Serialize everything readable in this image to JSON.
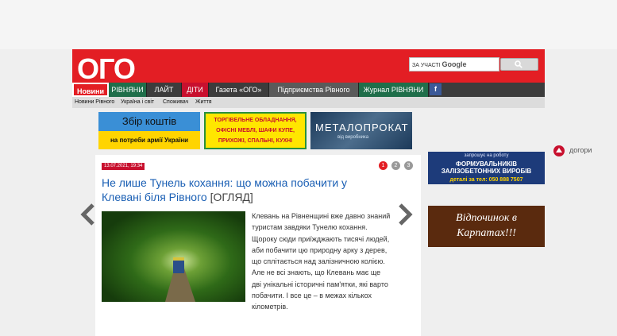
{
  "logo": "ОГО",
  "search": {
    "by": "ЗА УЧАСТІ",
    "brand": "Google"
  },
  "nav": [
    {
      "label": "Новини"
    },
    {
      "label": "РІВНЯНИ"
    },
    {
      "label": "ЛАЙТ"
    },
    {
      "label": "ДІТИ"
    },
    {
      "label": "Газета «ОГО»"
    },
    {
      "label": "Підприємства Рівного"
    },
    {
      "label": "Журнал РІВНЯНИ"
    },
    {
      "label": "f"
    }
  ],
  "subnav": [
    "Новини Рівного",
    "Україна і світ",
    "Споживач",
    "Життя"
  ],
  "banners": {
    "b1_line1": "Збір коштів",
    "b1_line2": "на потреби армії України",
    "b2": [
      "ТОРГІВЕЛЬНЕ ОБЛАДНАННЯ,",
      "ОФІСНІ МЕБЛІ, ШАФИ КУПЕ,",
      "ПРИХОЖІ, СПАЛЬНІ, КУХНІ"
    ],
    "b3_line1": "МЕТАЛОПРОКАТ",
    "b3_line2": "від виробника"
  },
  "article": {
    "date": "13.07.2021, 19:34",
    "pages": [
      "1",
      "2",
      "3"
    ],
    "title": "Не лише Тунель кохання: що можна побачити у Клевані біля Рівного",
    "tag": "[ОГЛЯД]",
    "body": "Клевань на Рівненщині вже давно знаний туристам завдяки Тунелю кохання. Щороку сюди приїжджають тисячі людей, аби побачити цю природну арку з дерев, що сплітається над залізничною колією. Але не всі знають, що Клевань має ще дві унікальні історичні пам'ятки, які варто побачити. І все це – в межах кількох кілометрів."
  },
  "right": {
    "ad1_top": "запрошує на роботу",
    "ad1_main": "ФОРМУВАЛЬНИКІВ ЗАЛІЗОБЕТОННИХ ВИРОБІВ",
    "ad1_phone": "деталі за тел: 050 888 7507",
    "ad2": "Відпочинок в Карпатах!!!",
    "side": "догори"
  },
  "colors": {
    "brand_red": "#e31e24",
    "nav_dark": "#3c3c3c",
    "link_blue": "#1a5fb4"
  }
}
